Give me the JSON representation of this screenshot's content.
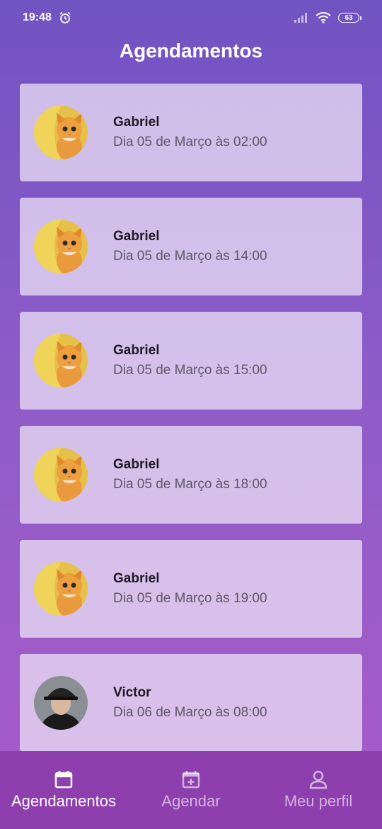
{
  "status_bar": {
    "time": "19:48",
    "battery": "63",
    "icons": [
      "alarm-icon",
      "signal-icon",
      "wifi-icon",
      "battery-icon"
    ]
  },
  "header": {
    "title": "Agendamentos"
  },
  "appointments": [
    {
      "name": "Gabriel",
      "date": "Dia 05 de Março às 02:00",
      "avatar": "cat-avatar"
    },
    {
      "name": "Gabriel",
      "date": "Dia 05 de Março às 14:00",
      "avatar": "cat-avatar"
    },
    {
      "name": "Gabriel",
      "date": "Dia 05 de Março às 15:00",
      "avatar": "cat-avatar"
    },
    {
      "name": "Gabriel",
      "date": "Dia 05 de Março às 18:00",
      "avatar": "cat-avatar"
    },
    {
      "name": "Gabriel",
      "date": "Dia 05 de Março às 19:00",
      "avatar": "cat-avatar"
    },
    {
      "name": "Victor",
      "date": "Dia 06 de Março às 08:00",
      "avatar": "person-avatar"
    }
  ],
  "nav": {
    "items": [
      {
        "label": "Agendamentos",
        "icon": "calendar-icon",
        "active": true
      },
      {
        "label": "Agendar",
        "icon": "calendar-add-icon",
        "active": false
      },
      {
        "label": "Meu perfil",
        "icon": "user-icon",
        "active": false
      }
    ]
  },
  "colors": {
    "background_top": "#7153c2",
    "background_bottom": "#a95bc9",
    "nav_bar": "#8e3fae",
    "card": "#e8ddf4"
  }
}
